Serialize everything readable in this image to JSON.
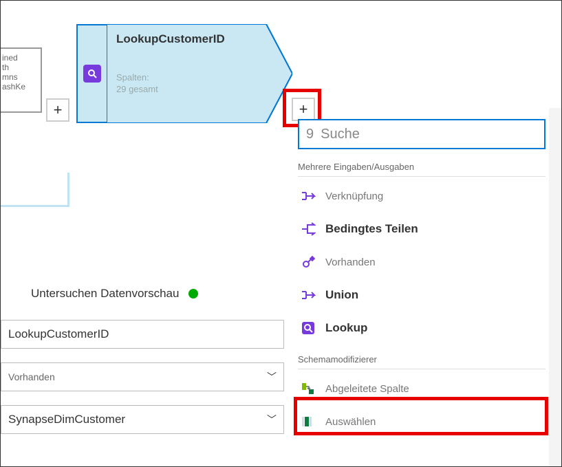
{
  "truncated": {
    "l1": "ined",
    "l2": "th",
    "l3": "mns",
    "l4": "ashKe"
  },
  "node": {
    "title": "LookupCustomerID",
    "columns_label": "Spalten:",
    "columns_count": "29 gesamt"
  },
  "search": {
    "glyph": "9",
    "placeholder": "Suche"
  },
  "sections": {
    "multi": "Mehrere Eingaben/Ausgaben",
    "schema": "Schemamodifizierer"
  },
  "transforms": {
    "join": "Verknüpfung",
    "split": "Bedingtes Teilen",
    "exists": "Vorhanden",
    "union": "Union",
    "lookup": "Lookup",
    "derived": "Abgeleitete Spalte",
    "select": "Auswählen"
  },
  "inspect": "Untersuchen Datenvorschau",
  "form": {
    "name": "LookupCustomerID",
    "exists": "Vorhanden",
    "source": "SynapseDimCustomer"
  },
  "colors": {
    "accent": "#0078d4",
    "purple": "#773adc",
    "highlight": "#e60000"
  }
}
